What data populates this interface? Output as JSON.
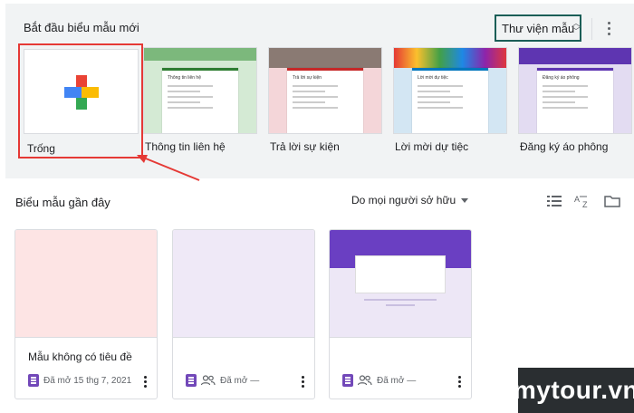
{
  "gallery": {
    "title": "Bắt đầu biểu mẫu mới",
    "library_button": "Thư viện mẫu",
    "templates": [
      {
        "label": "Trống"
      },
      {
        "label": "Thông tin liên hệ",
        "mini_title": "Thông tin liên hệ",
        "accent": "#2e7d32",
        "bg": "#d4ead4"
      },
      {
        "label": "Trả lời sự kiện",
        "mini_title": "Trả lời sự kiện",
        "accent": "#c62828",
        "bg": "#f4d6d9"
      },
      {
        "label": "Lời mời dự tiệc",
        "mini_title": "Lời mời dự tiệc",
        "accent": "#0277bd",
        "bg": "#d3e6f3"
      },
      {
        "label": "Đăng ký áo phông",
        "mini_title": "Đăng ký áo phông",
        "accent": "#5e35b1",
        "bg": "#e3dcf2"
      }
    ]
  },
  "recent": {
    "title": "Biểu mẫu gần đây",
    "owner_filter": "Do mọi người sở hữu",
    "docs": [
      {
        "title": "Mẫu không có tiêu đề",
        "meta": "Đã mở 15 thg 7, 2021",
        "thumb_color": "#fde4e4"
      },
      {
        "title": "",
        "meta": "Đã mở —",
        "thumb_color": "#efe9f7"
      },
      {
        "title": "",
        "meta": "Đã mở —",
        "thumb_color": "#ede7f6"
      }
    ]
  },
  "watermark": "mytour.vn",
  "icons": [
    "more-vert-icon",
    "unfold-icon",
    "list-view-icon",
    "sort-az-icon",
    "folder-icon",
    "forms-icon",
    "shared-people-icon",
    "plus-icon"
  ],
  "colors": {
    "highlight_border": "#e53935",
    "library_border": "#1b5e57",
    "forms_purple": "#7248b9"
  }
}
